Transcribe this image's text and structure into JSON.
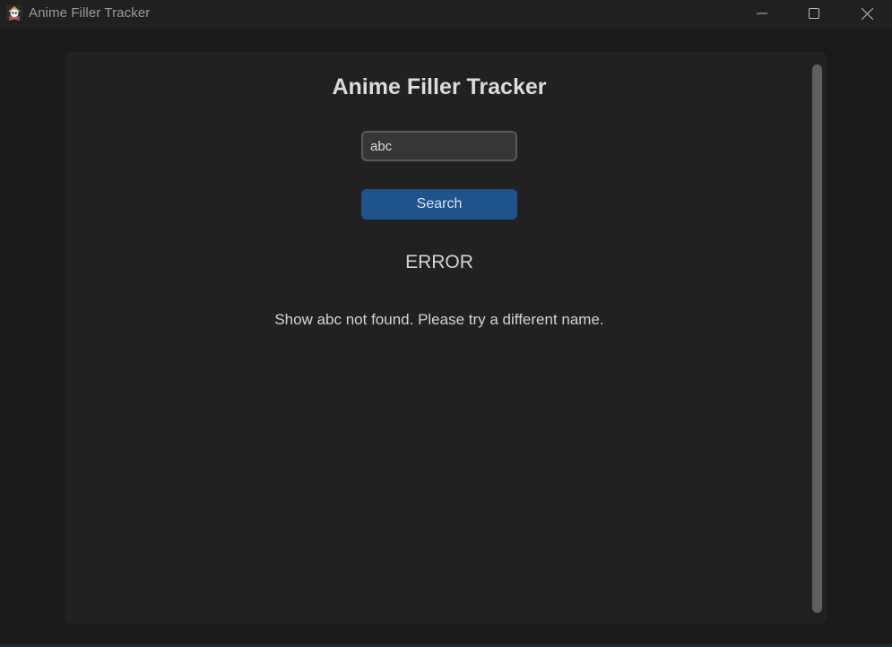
{
  "window": {
    "title": "Anime Filler Tracker",
    "icon": "pirate-skull-icon"
  },
  "controls": {
    "minimize_icon": "minimize-icon",
    "maximize_icon": "maximize-icon",
    "close_icon": "close-icon"
  },
  "main": {
    "heading": "Anime Filler Tracker",
    "search": {
      "value": "abc",
      "placeholder": ""
    },
    "search_button_label": "Search",
    "error_title": "ERROR",
    "error_message": "Show abc not found. Please try a different name."
  },
  "colors": {
    "background": "#1a1a1a",
    "panel": "#212121",
    "button": "#1f538d",
    "input_bg": "#343638",
    "input_border": "#565b5e",
    "scrollbar_thumb": "#5f5f5f"
  }
}
